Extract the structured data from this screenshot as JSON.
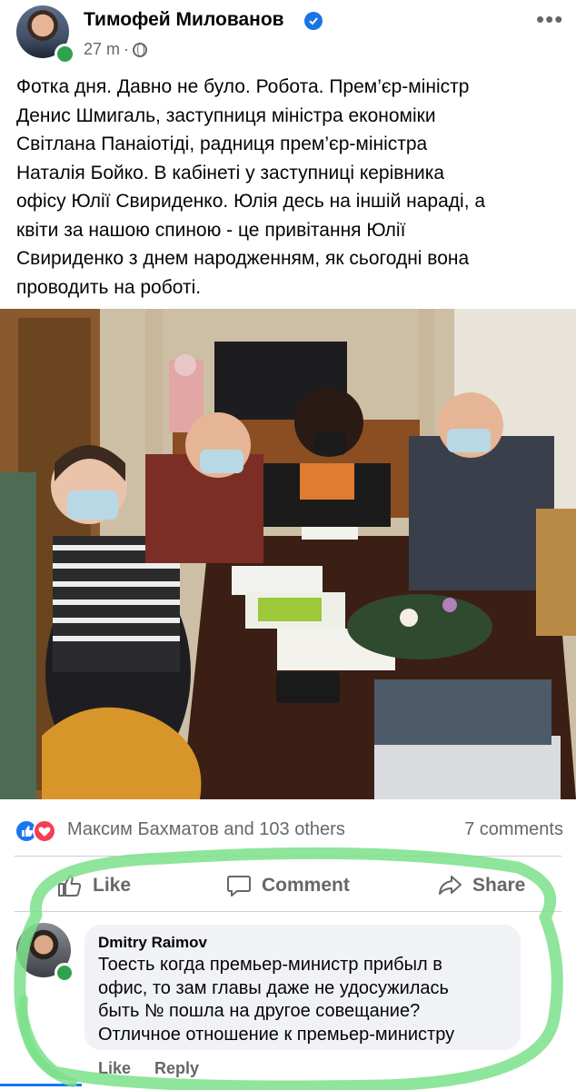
{
  "post": {
    "author": "Тимофей Милованов",
    "time": "27 m",
    "separator": "·",
    "text": "Фотка дня. Давно не було. Робота. Прем’єр-міністр\nДенис Шмигаль, заступниця міністра економіки\nСвітлана Панаіотіді, радниця прем’єр-міністра\nНаталія Бойко. В кабінеті у заступниці керівника\nофісу Юлії Свириденко. Юлія десь на іншій нараді, а\nквіти за нашою спиною - це привітання Юлії\nСвириденко з днем народженням, як сьогодні вона\nпроводить на роботі."
  },
  "reactions": {
    "names": "Максим Бахматов and 103 others",
    "comments": "7 comments"
  },
  "actions": {
    "like": "Like",
    "comment": "Comment",
    "share": "Share"
  },
  "comment": {
    "author": "Dmitry Raimov",
    "text": "Тоесть когда премьер-министр прибыл в\nофис, то зам главы даже не удосужилась\nбыть № пошла на другое совещание?\nОтличное отношение к премьер-министру",
    "like": "Like",
    "reply": "Reply"
  },
  "colors": {
    "facebook_blue": "#1877f2",
    "highlight_green": "#7be08a",
    "meta_gray": "#65676b"
  }
}
